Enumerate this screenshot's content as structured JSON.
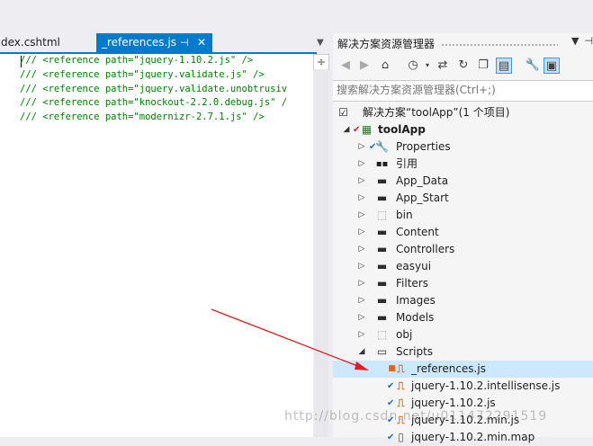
{
  "editor": {
    "tabs": [
      {
        "label": "dex.cshtml"
      },
      {
        "label": "_references.js",
        "pin": "⊣",
        "close": "✕"
      }
    ],
    "lines": [
      "/// <reference path=\"jquery-1.10.2.js\" />",
      "/// <reference path=\"jquery.validate.js\" />",
      "/// <reference path=\"jquery.validate.unobtrusiv",
      "/// <reference path=\"knockout-2.2.0.debug.js\" /",
      "/// <reference path=\"modernizr-2.7.1.js\" />"
    ],
    "split_glyph": "÷"
  },
  "solution_explorer": {
    "title": "解决方案资源管理器",
    "search_placeholder": "搜索解决方案资源管理器(Ctrl+;)",
    "toolbar_icons": [
      "back-icon",
      "forward-icon",
      "home-icon",
      "history-icon",
      "sync-icon",
      "refresh-icon",
      "collapse-all-icon",
      "show-all-files-icon",
      "properties-icon",
      "preview-icon"
    ],
    "tree": [
      {
        "label": "解决方案“toolApp”(1 个项目)",
        "icon": "solution-icon",
        "indent": 0,
        "expander": ""
      },
      {
        "label": "toolApp",
        "icon": "web-project-icon",
        "indent": 1,
        "expander": "◢",
        "bold": true
      },
      {
        "label": "Properties",
        "icon": "wrench-icon",
        "indent": 2,
        "expander": "▷"
      },
      {
        "label": "引用",
        "icon": "references-icon",
        "indent": 2,
        "expander": "▷"
      },
      {
        "label": "App_Data",
        "icon": "folder-icon",
        "indent": 2,
        "expander": "▷"
      },
      {
        "label": "App_Start",
        "icon": "folder-icon",
        "indent": 2,
        "expander": "▷"
      },
      {
        "label": "bin",
        "icon": "hidden-folder-icon",
        "indent": 2,
        "expander": "▷"
      },
      {
        "label": "Content",
        "icon": "folder-icon",
        "indent": 2,
        "expander": "▷"
      },
      {
        "label": "Controllers",
        "icon": "folder-icon",
        "indent": 2,
        "expander": "▷"
      },
      {
        "label": "easyui",
        "icon": "folder-icon",
        "indent": 2,
        "expander": "▷"
      },
      {
        "label": "Filters",
        "icon": "folder-icon",
        "indent": 2,
        "expander": "▷"
      },
      {
        "label": "Images",
        "icon": "folder-icon",
        "indent": 2,
        "expander": "▷"
      },
      {
        "label": "Models",
        "icon": "folder-icon",
        "indent": 2,
        "expander": "▷"
      },
      {
        "label": "obj",
        "icon": "hidden-folder-icon",
        "indent": 2,
        "expander": "▷"
      },
      {
        "label": "Scripts",
        "icon": "open-folder-icon",
        "indent": 2,
        "expander": "◢"
      },
      {
        "label": "_references.js",
        "icon": "js-file-icon",
        "indent": 3,
        "expander": "",
        "selected": true
      },
      {
        "label": "jquery-1.10.2.intellisense.js",
        "icon": "js-file-icon",
        "indent": 3,
        "expander": ""
      },
      {
        "label": "jquery-1.10.2.js",
        "icon": "js-file-icon",
        "indent": 3,
        "expander": ""
      },
      {
        "label": "jquery-1.10.2.min.js",
        "icon": "js-file-icon",
        "indent": 3,
        "expander": ""
      },
      {
        "label": "jquery-1.10.2.min.map",
        "icon": "map-file-icon",
        "indent": 3,
        "expander": ""
      }
    ]
  },
  "watermark": "http://blog.csdn.net/u011472291519",
  "colors": {
    "accent": "#007acc",
    "arrow": "#e02020",
    "selection": "#cce8ff"
  }
}
